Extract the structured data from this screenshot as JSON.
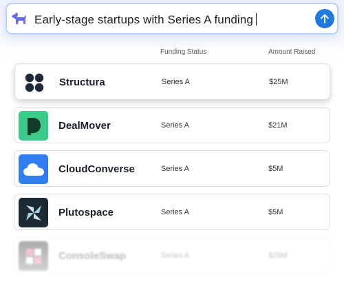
{
  "search": {
    "icon": "dog-icon",
    "query": "Early-stage startups with Series A funding",
    "submit_icon": "arrow-up-icon"
  },
  "table": {
    "headers": {
      "status": "Funding Status",
      "amount": "Amount Raised"
    },
    "rows": [
      {
        "name": "Structura",
        "status": "Series A",
        "amount": "$25M",
        "logo": "four-dots-icon",
        "logo_color": "#1f2937"
      },
      {
        "name": "DealMover",
        "status": "Series A",
        "amount": "$21M",
        "logo": "d-letter-icon",
        "logo_color": "#3cc98a"
      },
      {
        "name": "CloudConverse",
        "status": "Series A",
        "amount": "$5M",
        "logo": "cloud-icon",
        "logo_color": "#2f7df0"
      },
      {
        "name": "Plutospace",
        "status": "Series A",
        "amount": "$5M",
        "logo": "pinwheel-icon",
        "logo_color": "#1c2a33"
      },
      {
        "name": "ConsoleSwap",
        "status": "Series A",
        "amount": "$25M",
        "logo": "squares-icon",
        "logo_color": "#2b2b2b"
      }
    ]
  },
  "colors": {
    "accent": "#1f7ae0",
    "search_border": "#bcd2f6",
    "dog_icon": "#6a6ee8"
  }
}
